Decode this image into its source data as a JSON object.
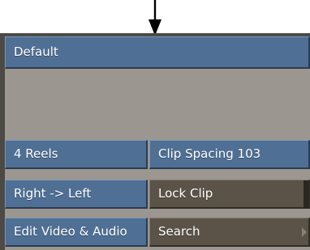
{
  "menu": {
    "title": "Default",
    "reels": "4 Reels",
    "clip_spacing": "Clip Spacing 103",
    "direction": "Right -> Left",
    "lock_clip": "Lock Clip",
    "edit_mode": "Edit Video & Audio",
    "search": "Search"
  },
  "icons": {
    "pointer_arrow": "arrow-down-icon",
    "submenu_indicator": "triangle-right-icon"
  },
  "colors": {
    "blue_button": "#4f6f95",
    "brown_button": "#5b5348",
    "panel_bg": "#9b968f"
  }
}
